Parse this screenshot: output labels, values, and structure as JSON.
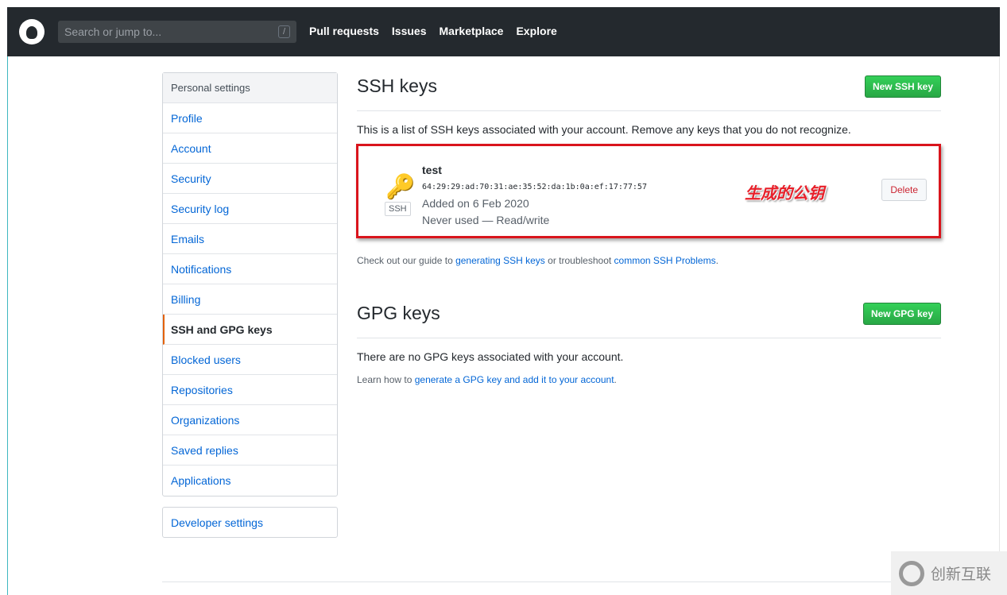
{
  "header": {
    "search_placeholder": "Search or jump to...",
    "search_shortcut": "/",
    "nav": [
      "Pull requests",
      "Issues",
      "Marketplace",
      "Explore"
    ]
  },
  "sidebar": {
    "title": "Personal settings",
    "items": [
      "Profile",
      "Account",
      "Security",
      "Security log",
      "Emails",
      "Notifications",
      "Billing",
      "SSH and GPG keys",
      "Blocked users",
      "Repositories",
      "Organizations",
      "Saved replies",
      "Applications"
    ],
    "selected": "SSH and GPG keys",
    "developer": "Developer settings"
  },
  "ssh": {
    "title": "SSH keys",
    "new_button": "New SSH key",
    "description": "This is a list of SSH keys associated with your account. Remove any keys that you do not recognize.",
    "key": {
      "name": "test",
      "badge": "SSH",
      "fingerprint": "64:29:29:ad:70:31:ae:35:52:da:1b:0a:ef:17:77:57",
      "added": "Added on 6 Feb 2020",
      "usage": "Never used — Read/write",
      "delete": "Delete"
    },
    "annotation": "生成的公钥",
    "guide_prefix": "Check out our guide to ",
    "guide_link1": "generating SSH keys",
    "guide_mid": " or troubleshoot ",
    "guide_link2": "common SSH Problems",
    "guide_suffix": "."
  },
  "gpg": {
    "title": "GPG keys",
    "new_button": "New GPG key",
    "empty": "There are no GPG keys associated with your account.",
    "learn_prefix": "Learn how to ",
    "learn_link": "generate a GPG key and add it to your account",
    "learn_suffix": "."
  },
  "watermark": "创新互联"
}
